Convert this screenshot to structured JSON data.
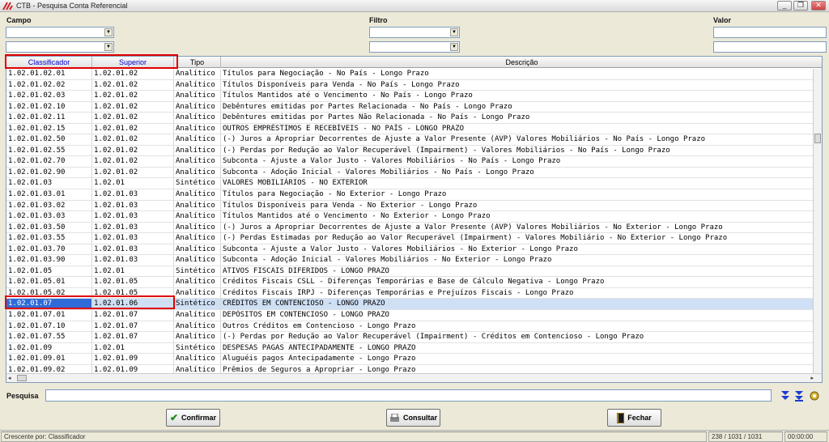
{
  "window": {
    "title": "CTB - Pesquisa Conta Referencial",
    "min": "_",
    "max": "❐",
    "close": "✕"
  },
  "filters": {
    "campo_label": "Campo",
    "filtro_label": "Filtro",
    "valor_label": "Valor"
  },
  "columns": [
    "Classificador",
    "Superior",
    "Tipo",
    "Descrição"
  ],
  "rows": [
    [
      "1.02.01.02.01",
      "1.02.01.02",
      "Analítico",
      "Títulos para Negociação - No País - Longo Prazo"
    ],
    [
      "1.02.01.02.02",
      "1.02.01.02",
      "Analítico",
      "Títulos Disponíveis para Venda - No País - Longo Prazo"
    ],
    [
      "1.02.01.02.03",
      "1.02.01.02",
      "Analítico",
      "Títulos Mantidos até o Vencimento - No País - Longo Prazo"
    ],
    [
      "1.02.01.02.10",
      "1.02.01.02",
      "Analítico",
      "Debêntures emitidas por Partes Relacionada - No País - Longo Prazo"
    ],
    [
      "1.02.01.02.11",
      "1.02.01.02",
      "Analítico",
      "Debêntures emitidas por Partes Não Relacionada - No País - Longo Prazo"
    ],
    [
      "1.02.01.02.15",
      "1.02.01.02",
      "Analítico",
      "OUTROS EMPRÉSTIMOS E RECEBÍVEIS - NO PAÍS - LONGO PRAZO"
    ],
    [
      "1.02.01.02.50",
      "1.02.01.02",
      "Analítico",
      " (-) Juros a Apropriar Decorrentes de Ajuste a Valor Presente (AVP) Valores Mobiliários - No País - Longo Prazo"
    ],
    [
      "1.02.01.02.55",
      "1.02.01.02",
      "Analítico",
      " (-) Perdas por Redução ao Valor Recuperável (Impairment) - Valores Mobiliários - No País - Longo Prazo"
    ],
    [
      "1.02.01.02.70",
      "1.02.01.02",
      "Analítico",
      "Subconta - Ajuste a Valor Justo - Valores Mobiliários - No País - Longo Prazo"
    ],
    [
      "1.02.01.02.90",
      "1.02.01.02",
      "Analítico",
      "Subconta - Adoção Inicial - Valores Mobiliários - No País - Longo Prazo"
    ],
    [
      "1.02.01.03",
      "1.02.01",
      "Sintético",
      "VALORES MOBILIÁRIOS - NO EXTERIOR"
    ],
    [
      "1.02.01.03.01",
      "1.02.01.03",
      "Analítico",
      "Títulos para Negociação - No Exterior - Longo Prazo"
    ],
    [
      "1.02.01.03.02",
      "1.02.01.03",
      "Analítico",
      "Títulos Disponíveis para Venda - No Exterior - Longo Prazo"
    ],
    [
      "1.02.01.03.03",
      "1.02.01.03",
      "Analítico",
      "Títulos Mantidos até o Vencimento - No Exterior - Longo Prazo"
    ],
    [
      "1.02.01.03.50",
      "1.02.01.03",
      "Analítico",
      " (-) Juros a Apropriar Decorrentes de Ajuste a Valor Presente (AVP) Valores Mobiliários - No Exterior - Longo Prazo"
    ],
    [
      "1.02.01.03.55",
      "1.02.01.03",
      "Analítico",
      " (-) Perdas Estimadas por Redução ao Valor Recuperável (Impairment) - Valores Mobiliário - No Exterior - Longo Prazo"
    ],
    [
      "1.02.01.03.70",
      "1.02.01.03",
      "Analítico",
      "Subconta - Ajuste a Valor Justo - Valores Mobiliários - No Exterior - Longo Prazo"
    ],
    [
      "1.02.01.03.90",
      "1.02.01.03",
      "Analítico",
      "Subconta - Adoção Inicial - Valores Mobiliários - No Exterior - Longo Prazo"
    ],
    [
      "1.02.01.05",
      "1.02.01",
      "Sintético",
      "ATIVOS FISCAIS DIFERIDOS - LONGO PRAZO"
    ],
    [
      "1.02.01.05.01",
      "1.02.01.05",
      "Analítico",
      "Créditos Fiscais CSLL - Diferenças Temporárias e Base de Cálculo Negativa - Longo Prazo"
    ],
    [
      "1.02.01.05.02",
      "1.02.01.05",
      "Analítico",
      "Créditos Fiscais IRPJ - Diferenças Temporárias e Prejuízos Fiscais - Longo Prazo"
    ],
    [
      "1.02.01.07",
      "1.02.01.06",
      "Sintético",
      "CRÉDITOS EM CONTENCIOSO - LONGO PRAZO"
    ],
    [
      "1.02.01.07.01",
      "1.02.01.07",
      "Analítico",
      "DEPÓSITOS EM CONTENCIOSO - LONGO PRAZO"
    ],
    [
      "1.02.01.07.10",
      "1.02.01.07",
      "Analítico",
      "Outros Créditos em Contencioso - Longo Prazo"
    ],
    [
      "1.02.01.07.55",
      "1.02.01.07",
      "Analítico",
      " (-) Perdas  por Redução ao Valor Recuperável (Impairment) - Créditos em Contencioso - Longo Prazo"
    ],
    [
      "1.02.01.09",
      "1.02.01",
      "Sintético",
      "DESPESAS PAGAS ANTECIPADAMENTE - LONGO PRAZO"
    ],
    [
      "1.02.01.09.01",
      "1.02.01.09",
      "Analítico",
      "Aluguéis pagos Antecipadamente - Longo Prazo"
    ],
    [
      "1.02.01.09.02",
      "1.02.01.09",
      "Analítico",
      "Prêmios de Seguros a Apropriar - Longo Prazo"
    ]
  ],
  "selected_row": 21,
  "search": {
    "label": "Pesquisa",
    "value": ""
  },
  "buttons": {
    "confirm": "Confirmar",
    "consult": "Consultar",
    "close": "Fechar"
  },
  "status": {
    "sort": "Crescente por: Classificador",
    "count": "238 / 1031 / 1031",
    "time": "00:00:00"
  },
  "colors": {
    "highlight": "#e00000",
    "selection": "#cfe0f4",
    "sorted_header": "#0000cc"
  }
}
